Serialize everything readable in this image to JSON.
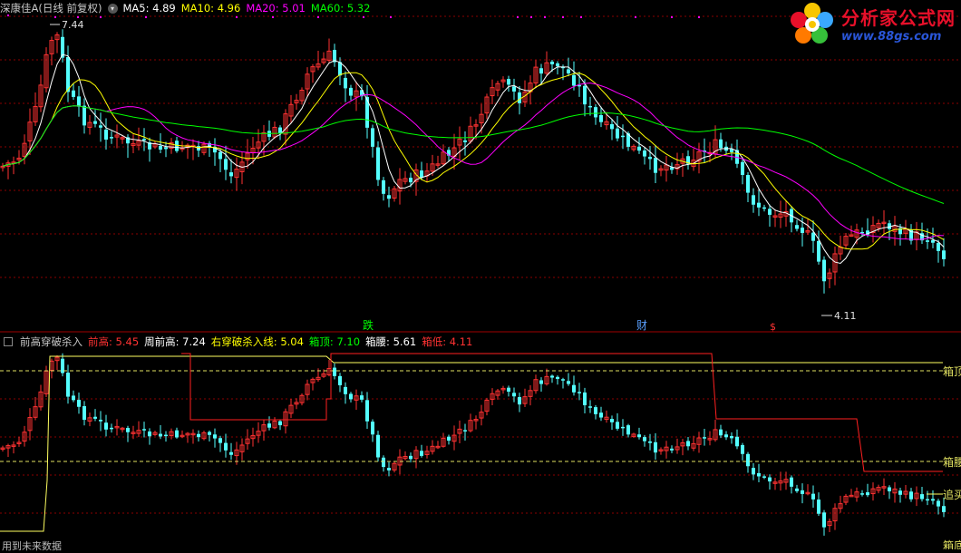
{
  "upper_header": {
    "stock": "深康佳A(日线 前复权)",
    "ma5_label": "MA5:",
    "ma5_value": "4.89",
    "ma10_label": "MA10:",
    "ma10_value": "4.96",
    "ma20_label": "MA20:",
    "ma20_value": "5.01",
    "ma60_label": "MA60:",
    "ma60_value": "5.32"
  },
  "lower_header": {
    "indicator": "前高穿破杀入",
    "prev_high_label": "前高:",
    "prev_high_value": "5.45",
    "week_high_label": "周前高:",
    "week_high_value": "7.24",
    "break_label": "右穿破杀入线:",
    "break_value": "5.04",
    "box_top_label": "箱顶:",
    "box_top_value": "7.10",
    "box_mid_label": "箱腰:",
    "box_mid_value": "5.61",
    "box_low_label": "箱低:",
    "box_low_value": "4.11"
  },
  "price_labels": {
    "high": "7.44",
    "low": "4.11"
  },
  "event_markers": {
    "die": "跌",
    "cai": "财",
    "dollar": "$"
  },
  "right_labels": {
    "box_top": "箱顶",
    "box_mid": "箱腰",
    "chase": "追买",
    "bottom": "箱底"
  },
  "bottom_note": "用到未来数据",
  "logo": {
    "title": "分析家公式网",
    "url": "www.88gs.com"
  },
  "colors": {
    "up": "#ff3232",
    "down": "#54ffff",
    "ma5": "#ffffff",
    "ma10": "#ffff00",
    "ma20": "#ff00ff",
    "ma60": "#00ff00",
    "grid": "#8b0000",
    "text_header": "#c8c8c8"
  }
}
